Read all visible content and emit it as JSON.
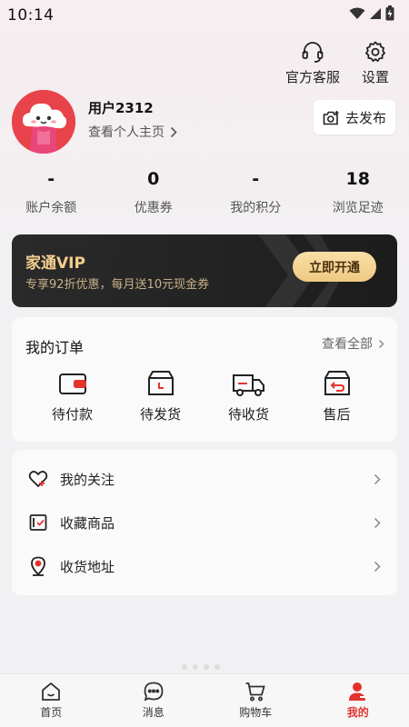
{
  "status": {
    "time": "10:14"
  },
  "header": {
    "service_label": "官方客服",
    "settings_label": "设置"
  },
  "profile": {
    "username": "用户2312",
    "profile_link": "查看个人主页",
    "publish_label": "去发布"
  },
  "stats": [
    {
      "value": "-",
      "label": "账户余额"
    },
    {
      "value": "0",
      "label": "优惠券"
    },
    {
      "value": "-",
      "label": "我的积分"
    },
    {
      "value": "18",
      "label": "浏览足迹"
    }
  ],
  "vip": {
    "title": "家通VIP",
    "description": "专享92折优惠，每月送10元现金券",
    "button_label": "立即开通"
  },
  "orders": {
    "title": "我的订单",
    "see_all": "查看全部",
    "items": [
      {
        "label": "待付款",
        "icon": "wallet-icon"
      },
      {
        "label": "待发货",
        "icon": "box-icon"
      },
      {
        "label": "待收货",
        "icon": "truck-icon"
      },
      {
        "label": "售后",
        "icon": "return-box-icon"
      }
    ]
  },
  "links": [
    {
      "label": "我的关注",
      "icon": "heart-plus-icon"
    },
    {
      "label": "收藏商品",
      "icon": "collection-icon"
    },
    {
      "label": "收货地址",
      "icon": "location-pin-icon"
    }
  ],
  "tabs": [
    {
      "label": "首页",
      "icon": "home-icon"
    },
    {
      "label": "消息",
      "icon": "message-icon"
    },
    {
      "label": "购物车",
      "icon": "cart-icon"
    },
    {
      "label": "我的",
      "icon": "user-icon",
      "active": true
    }
  ],
  "colors": {
    "accent": "#e5322d",
    "vip_gold": "#f3cf8e",
    "vip_bg": "#222222"
  }
}
